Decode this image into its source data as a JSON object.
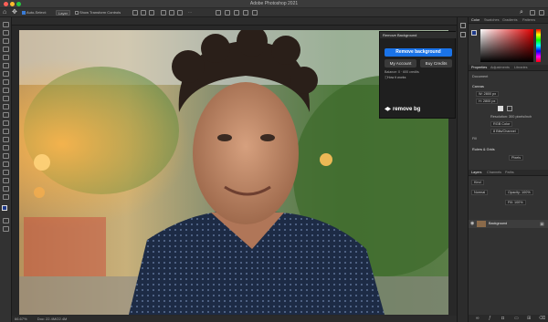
{
  "window": {
    "title": "Adobe Photoshop 2021"
  },
  "options_bar": {
    "auto_select_label": "Auto-Select:",
    "auto_select_value": "Layer",
    "transform_label": "Show Transform Controls",
    "more_label": "···"
  },
  "remove_bg": {
    "header": "Remove Background",
    "remove_button": "Remove background",
    "account_button": "My Account",
    "credits_button": "Buy Credits",
    "credits_text": "Balance: 0 · 600 credits",
    "how_link": "How it works",
    "logo": "remove bg"
  },
  "panels": {
    "color_tabs": [
      "Color",
      "Swatches",
      "Gradients",
      "Patterns"
    ],
    "prop_tabs": [
      "Properties",
      "Adjustments",
      "Libraries"
    ],
    "document_label": "Document",
    "canvas_label": "Canvas",
    "width": "W: 2800 px",
    "height": "H: 2800 px",
    "resolution": "Resolution: 300 pixels/inch",
    "mode": "RGB Color",
    "depth": "8 Bits/Channel",
    "fill_label": "Fill",
    "rulers_label": "Rulers & Grids",
    "units": "Pixels",
    "layer_tabs": [
      "Layers",
      "Channels",
      "Paths"
    ],
    "kind_label": "Kind",
    "blend_mode": "Normal",
    "opacity": "Opacity: 100%",
    "fill_pct": "Fill: 100%",
    "layer_name": "Background"
  },
  "status": {
    "zoom": "66.67%",
    "doc": "Doc: 22.4M/22.4M"
  },
  "colors": {
    "accent": "#1a73e8",
    "foreground": "#1f3a8a",
    "background": "#ffffff"
  }
}
